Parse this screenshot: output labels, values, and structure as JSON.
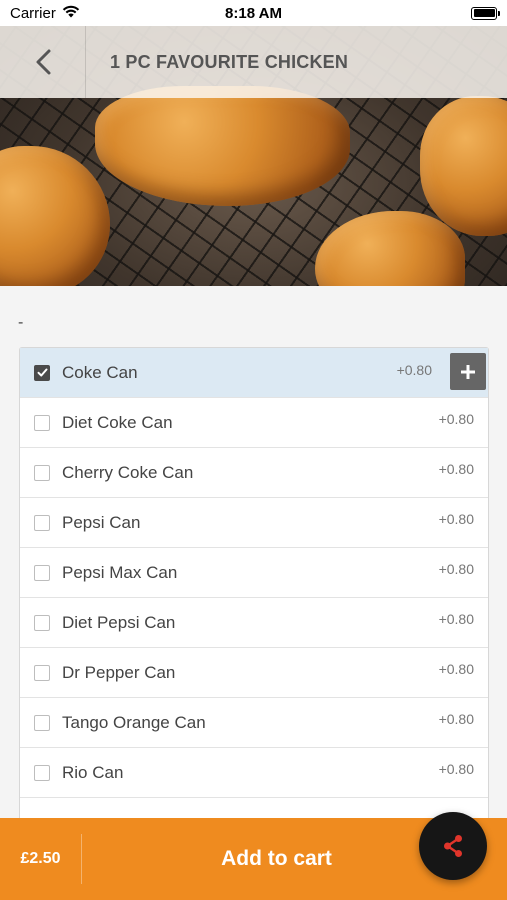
{
  "status_bar": {
    "carrier": "Carrier",
    "time": "8:18 AM"
  },
  "header": {
    "title": "1 PC FAVOURITE CHICKEN"
  },
  "group": {
    "label": "-"
  },
  "options": [
    {
      "label": "Coke Can",
      "price": "+0.80",
      "checked": true
    },
    {
      "label": "Diet Coke Can",
      "price": "+0.80",
      "checked": false
    },
    {
      "label": "Cherry Coke Can",
      "price": "+0.80",
      "checked": false
    },
    {
      "label": "Pepsi Can",
      "price": "+0.80",
      "checked": false
    },
    {
      "label": "Pepsi Max Can",
      "price": "+0.80",
      "checked": false
    },
    {
      "label": "Diet Pepsi Can",
      "price": "+0.80",
      "checked": false
    },
    {
      "label": "Dr Pepper Can",
      "price": "+0.80",
      "checked": false
    },
    {
      "label": "Tango Orange Can",
      "price": "+0.80",
      "checked": false
    },
    {
      "label": "Rio Can",
      "price": "+0.80",
      "checked": false
    },
    {
      "label": "",
      "price": "",
      "checked": false
    }
  ],
  "footer": {
    "price": "£2.50",
    "add_to_cart": "Add to cart"
  },
  "icons": {
    "back": "chevron-left-icon",
    "share": "share-icon",
    "plus": "plus-icon",
    "wifi": "wifi-icon",
    "battery": "battery-icon"
  },
  "colors": {
    "accent": "#ef8b1f",
    "fab": "#161616",
    "share_icon": "#e0352b",
    "selected_row": "#dce9f3"
  }
}
